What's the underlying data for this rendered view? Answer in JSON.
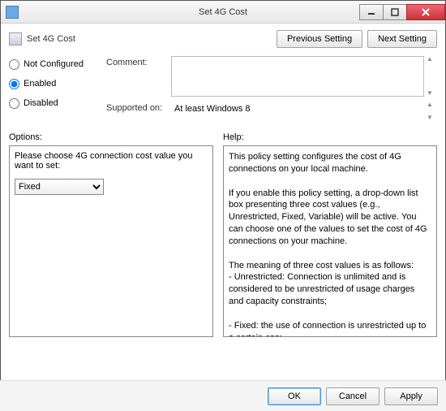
{
  "window": {
    "title": "Set 4G Cost"
  },
  "header": {
    "title": "Set 4G Cost",
    "prev_btn": "Previous Setting",
    "next_btn": "Next Setting"
  },
  "state_radios": {
    "not_configured": "Not Configured",
    "enabled": "Enabled",
    "disabled": "Disabled",
    "selected": "enabled"
  },
  "fields": {
    "comment_label": "Comment:",
    "comment_value": "",
    "supported_label": "Supported on:",
    "supported_value": "At least Windows 8"
  },
  "options": {
    "section_label": "Options:",
    "prompt": "Please choose 4G connection cost value you want to set:",
    "dropdown_value": "Fixed"
  },
  "help": {
    "section_label": "Help:",
    "text": "This policy setting configures the cost of 4G connections on your local machine.\n\nIf you enable this policy setting, a drop-down list box presenting three cost values (e.g., Unrestricted, Fixed, Variable) will be active. You can choose one of the values to set the cost of 4G connections on your machine.\n\nThe meaning of three cost values is as follows:\n- Unrestricted: Connection is unlimited and is considered to be unrestricted of usage charges and capacity constraints;\n\n- Fixed: the use of connection is unrestricted up to a certain cap;\n\n- Variable: connection is costed on a per byte base."
  },
  "footer": {
    "ok": "OK",
    "cancel": "Cancel",
    "apply": "Apply"
  }
}
